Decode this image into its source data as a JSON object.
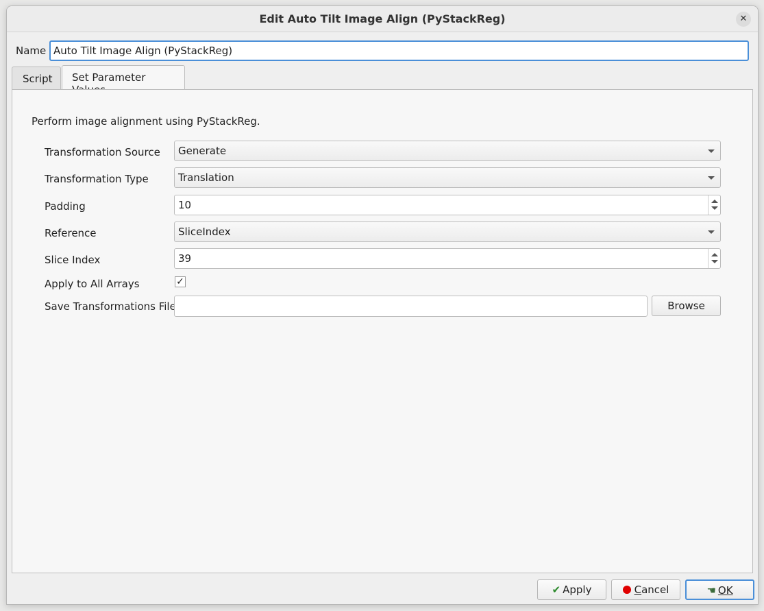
{
  "window": {
    "title": "Edit Auto Tilt Image Align (PyStackReg)",
    "close_glyph": "✕"
  },
  "name_field": {
    "label": "Name",
    "value": "Auto Tilt Image Align (PyStackReg)"
  },
  "tabs": [
    {
      "label": "Script",
      "active": false
    },
    {
      "label": "Set Parameter Values",
      "active": true
    }
  ],
  "description": "Perform image alignment using PyStackReg.",
  "params": {
    "transformation_source": {
      "label": "Transformation Source",
      "value": "Generate"
    },
    "transformation_type": {
      "label": "Transformation Type",
      "value": "Translation"
    },
    "padding": {
      "label": "Padding",
      "value": "10"
    },
    "reference": {
      "label": "Reference",
      "value": "SliceIndex"
    },
    "slice_index": {
      "label": "Slice Index",
      "value": "39"
    },
    "apply_all": {
      "label": "Apply to All Arrays",
      "checked": true,
      "glyph": "✓"
    },
    "save_file": {
      "label": "Save Transformations File",
      "value": "",
      "browse_label": "Browse"
    }
  },
  "buttons": {
    "apply": {
      "icon": "check-icon",
      "glyph": "✔",
      "label": "Apply"
    },
    "cancel": {
      "icon": "red-dot-icon",
      "accel": "C",
      "rest": "ancel"
    },
    "ok": {
      "icon": "hand-icon",
      "glyph": "☚",
      "label": "OK"
    }
  },
  "colors": {
    "accent": "#4a8fd8",
    "cancel_dot": "#e00000",
    "apply_check": "#2c8a2c"
  }
}
